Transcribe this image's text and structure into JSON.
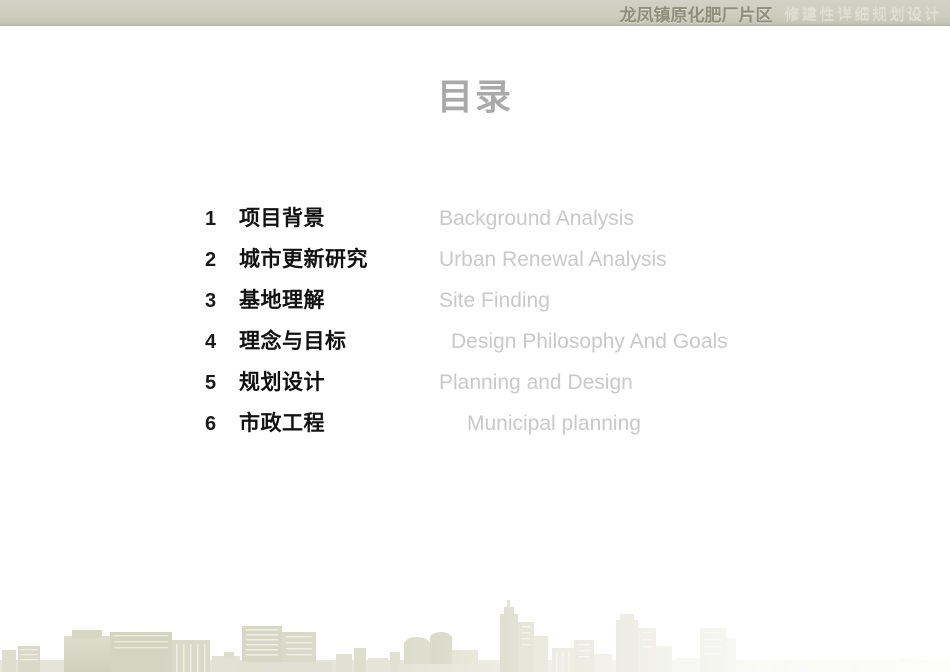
{
  "banner": {
    "project_title": "龙凤镇原化肥厂片区",
    "project_subtitle": "修建性详细规划设计"
  },
  "slide": {
    "title": "目录"
  },
  "contents": {
    "items": [
      {
        "number": "1",
        "label_cn": "项目背景",
        "label_en": "Background Analysis"
      },
      {
        "number": "2",
        "label_cn": "城市更新研究",
        "label_en": "Urban Renewal Analysis"
      },
      {
        "number": "3",
        "label_cn": "基地理解",
        "label_en": "Site Finding"
      },
      {
        "number": "4",
        "label_cn": "理念与目标",
        "label_en": "Design Philosophy And Goals"
      },
      {
        "number": "5",
        "label_cn": "规划设计",
        "label_en": "Planning and Design"
      },
      {
        "number": "6",
        "label_cn": "市政工程",
        "label_en": "Municipal planning"
      }
    ]
  },
  "decoration": {
    "skyline_name": "city-skyline-silhouette"
  },
  "colors": {
    "banner_background": "#cdcdbe",
    "banner_title": "#8e8e7c",
    "banner_subtitle": "#dfdfd2",
    "slide_title": "#a9a9a9",
    "list_number": "#1a1a1a",
    "list_label_cn": "#121212",
    "list_label_en": "#c9c9c9",
    "skyline": "#d7d7c6",
    "page_background": "#ffffff"
  }
}
